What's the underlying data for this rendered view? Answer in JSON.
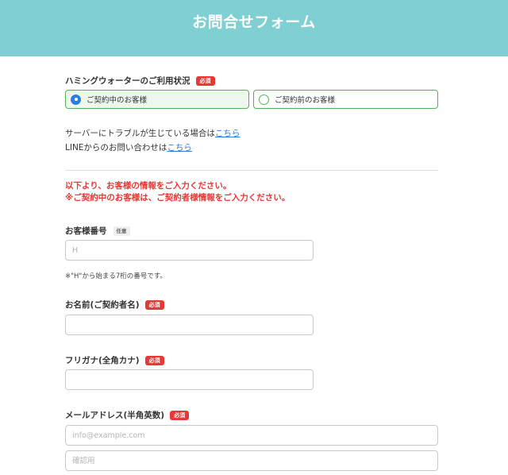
{
  "header": {
    "title": "お問合せフォーム"
  },
  "status": {
    "label": "ハミングウォーターのご利用状況",
    "required_badge": "必須",
    "options": [
      {
        "label": "ご契約中のお客様",
        "selected": true
      },
      {
        "label": "ご契約前のお客様",
        "selected": false
      }
    ]
  },
  "info": {
    "line1_text": "サーバーにトラブルが生じている場合は",
    "line1_link": "こちら",
    "line2_text": "LINEからのお問い合わせは",
    "line2_link": "こちら"
  },
  "notice": {
    "line1": "以下より、お客様の情報をご入力ください。",
    "line2": "※ご契約中のお客様は、ご契約者様情報をご入力ください。"
  },
  "fields": {
    "customer_number": {
      "label": "お客様番号",
      "badge": "任意",
      "placeholder": "H",
      "hint": "※\"H\"から始まる7桁の番号です。"
    },
    "name": {
      "label": "お名前(ご契約者名)",
      "badge": "必須",
      "placeholder": ""
    },
    "furigana": {
      "label": "フリガナ(全角カナ)",
      "badge": "必須",
      "placeholder": ""
    },
    "email": {
      "label": "メールアドレス(半角英数)",
      "badge": "必須",
      "placeholder": "info@example.com",
      "confirm_placeholder": "確認用"
    }
  },
  "colors": {
    "header_bg": "#7fcfd3",
    "required_badge": "#e53935",
    "radio_border": "#55b156",
    "link": "#2a7de1",
    "notice": "#e53935"
  }
}
